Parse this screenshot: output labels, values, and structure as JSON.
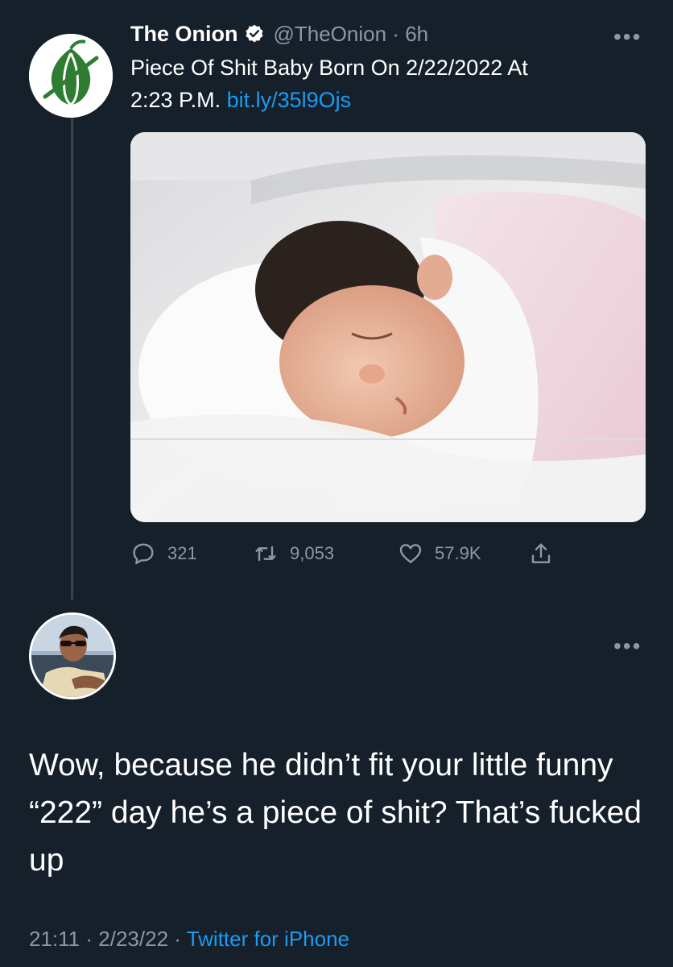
{
  "tweet": {
    "author_name": "The Onion",
    "handle": "@TheOnion",
    "separator": "·",
    "time": "6h",
    "text_line1": "Piece Of Shit Baby Born On 2/22/2022 At",
    "text_line2_prefix": "2:23 P.M.",
    "link": "bit.ly/35l9Ojs",
    "more_label": "•••",
    "reply_count": "321",
    "retweet_count": "9,053",
    "like_count": "57.9K"
  },
  "reply": {
    "more_label": "•••",
    "text": "Wow, because he didn’t fit your little funny “222” day he’s a piece of shit? That’s fucked up",
    "time": "21:11",
    "separator": "·",
    "date": "2/23/22",
    "source": "Twitter for iPhone"
  },
  "icons": {
    "verified": "verified-badge-icon",
    "reply": "reply-icon",
    "retweet": "retweet-icon",
    "like": "heart-icon",
    "share": "share-icon"
  },
  "colors": {
    "background": "#15202b",
    "secondary_text": "#8b98a5",
    "link": "#1d9bf0",
    "onion_green": "#2e7d32"
  }
}
